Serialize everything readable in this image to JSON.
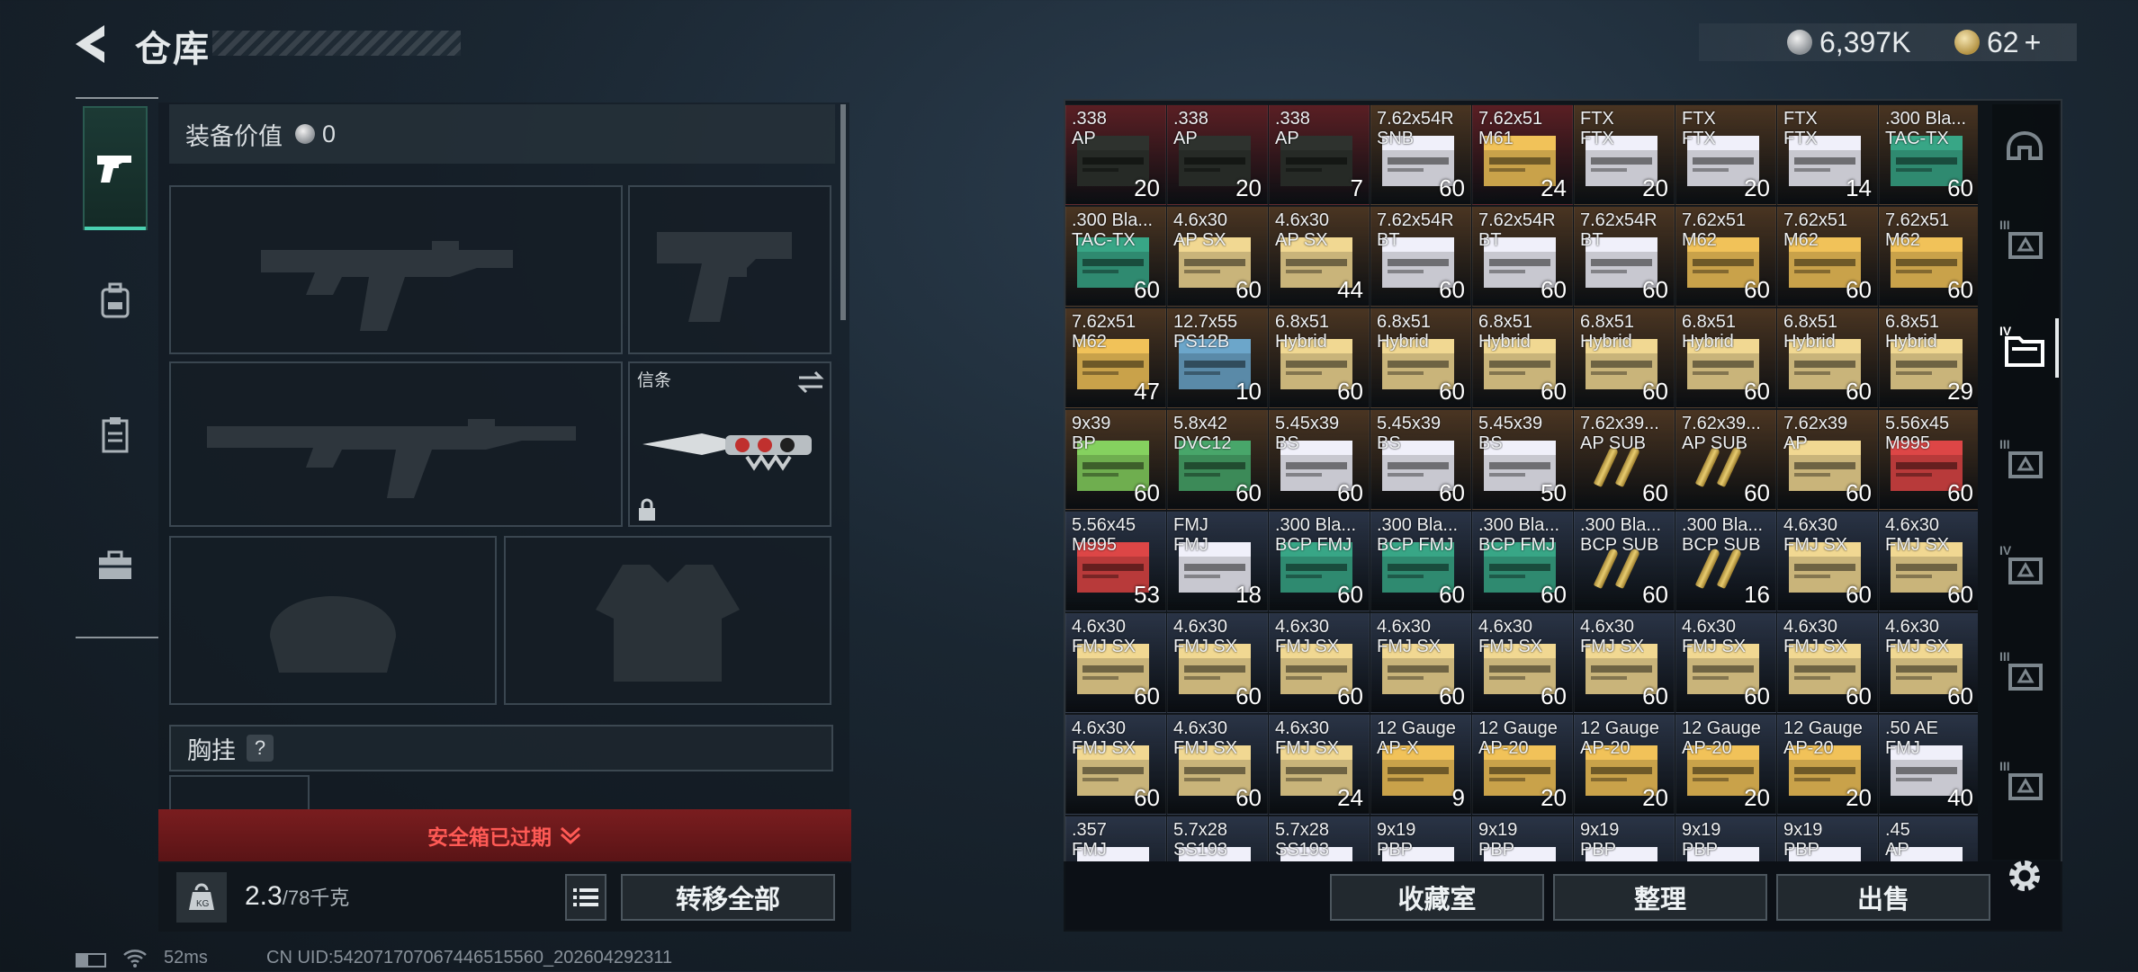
{
  "header": {
    "title": "仓库",
    "currencies": [
      {
        "icon": "silver-coin-icon",
        "value": "6,397K"
      },
      {
        "icon": "gold-coin-icon",
        "value": "62"
      }
    ],
    "add_label": "+"
  },
  "nav": {
    "items": [
      {
        "name": "weapons",
        "icon": "pistol-icon",
        "active": true
      },
      {
        "name": "backpack",
        "icon": "backpack-icon",
        "active": false
      },
      {
        "name": "clipboard",
        "icon": "clipboard-icon",
        "active": false
      },
      {
        "name": "case",
        "icon": "briefcase-icon",
        "active": false
      }
    ]
  },
  "loadout": {
    "equip_value_label": "装备价值",
    "equip_value": "0",
    "melee_slot_label": "信条",
    "chest_rig_label": "胸挂",
    "chest_rig_help": "?",
    "secure_container_status": "安全箱已过期",
    "weight_current": "2.3",
    "weight_max": "/78千克",
    "transfer_all_label": "转移全部"
  },
  "inventory": {
    "rows": [
      [
        {
          "l1": ".338",
          "l2": "AP",
          "count": "20",
          "color": "#262a26",
          "bg": "#5a1f24"
        },
        {
          "l1": ".338",
          "l2": "AP",
          "count": "20",
          "color": "#262a26",
          "bg": "#5a1f24"
        },
        {
          "l1": ".338",
          "l2": "AP",
          "count": "7",
          "color": "#262a26",
          "bg": "#5a1f24"
        },
        {
          "l1": "7.62x54R",
          "l2": "SNB",
          "count": "60",
          "color": "#c8c8d0",
          "bg": "#4a3522"
        },
        {
          "l1": "7.62x51",
          "l2": "M61",
          "count": "24",
          "color": "#c9a24a",
          "bg": "#5a1f24"
        },
        {
          "l1": "FTX",
          "l2": "FTX",
          "count": "20",
          "color": "#c8c8d0",
          "bg": "#4a3522"
        },
        {
          "l1": "FTX",
          "l2": "FTX",
          "count": "20",
          "color": "#c8c8d0",
          "bg": "#4a3522"
        },
        {
          "l1": "FTX",
          "l2": "FTX",
          "count": "14",
          "color": "#c8c8d0",
          "bg": "#4a3522"
        },
        {
          "l1": ".300 Bla...",
          "l2": "TAC-TX",
          "count": "60",
          "color": "#2f8a70",
          "bg": "#4a3522"
        }
      ],
      [
        {
          "l1": ".300 Bla...",
          "l2": "TAC-TX",
          "count": "60",
          "color": "#2f8a70",
          "bg": "#4a3522"
        },
        {
          "l1": "4.6x30",
          "l2": "AP SX",
          "count": "60",
          "color": "#c9b47a",
          "bg": "#4a3522"
        },
        {
          "l1": "4.6x30",
          "l2": "AP SX",
          "count": "44",
          "color": "#c9b47a",
          "bg": "#4a3522"
        },
        {
          "l1": "7.62x54R",
          "l2": "BT",
          "count": "60",
          "color": "#c8c8d0",
          "bg": "#4a3522"
        },
        {
          "l1": "7.62x54R",
          "l2": "BT",
          "count": "60",
          "color": "#c8c8d0",
          "bg": "#4a3522"
        },
        {
          "l1": "7.62x54R",
          "l2": "BT",
          "count": "60",
          "color": "#c8c8d0",
          "bg": "#4a3522"
        },
        {
          "l1": "7.62x51",
          "l2": "M62",
          "count": "60",
          "color": "#c9a24a",
          "bg": "#4a3522"
        },
        {
          "l1": "7.62x51",
          "l2": "M62",
          "count": "60",
          "color": "#c9a24a",
          "bg": "#4a3522"
        },
        {
          "l1": "7.62x51",
          "l2": "M62",
          "count": "60",
          "color": "#c9a24a",
          "bg": "#4a3522"
        }
      ],
      [
        {
          "l1": "7.62x51",
          "l2": "M62",
          "count": "47",
          "color": "#c9a24a",
          "bg": "#4a3522"
        },
        {
          "l1": "12.7x55",
          "l2": "PS12B",
          "count": "10",
          "color": "#5a8aa8",
          "bg": "#4a3522"
        },
        {
          "l1": "6.8x51",
          "l2": "Hybrid",
          "count": "60",
          "color": "#c9b47a",
          "bg": "#4a3522"
        },
        {
          "l1": "6.8x51",
          "l2": "Hybrid",
          "count": "60",
          "color": "#c9b47a",
          "bg": "#4a3522"
        },
        {
          "l1": "6.8x51",
          "l2": "Hybrid",
          "count": "60",
          "color": "#c9b47a",
          "bg": "#4a3522"
        },
        {
          "l1": "6.8x51",
          "l2": "Hybrid",
          "count": "60",
          "color": "#c9b47a",
          "bg": "#4a3522"
        },
        {
          "l1": "6.8x51",
          "l2": "Hybrid",
          "count": "60",
          "color": "#c9b47a",
          "bg": "#4a3522"
        },
        {
          "l1": "6.8x51",
          "l2": "Hybrid",
          "count": "60",
          "color": "#c9b47a",
          "bg": "#4a3522"
        },
        {
          "l1": "6.8x51",
          "l2": "Hybrid",
          "count": "29",
          "color": "#c9b47a",
          "bg": "#4a3522"
        }
      ],
      [
        {
          "l1": "9x39",
          "l2": "BP",
          "count": "60",
          "color": "#6fae4f",
          "bg": "#4a3522"
        },
        {
          "l1": "5.8x42",
          "l2": "DVC12",
          "count": "60",
          "color": "#3c8a58",
          "bg": "#4a3522"
        },
        {
          "l1": "5.45x39",
          "l2": "BS",
          "count": "60",
          "color": "#c8c8d0",
          "bg": "#4a3522"
        },
        {
          "l1": "5.45x39",
          "l2": "BS",
          "count": "60",
          "color": "#c8c8d0",
          "bg": "#4a3522"
        },
        {
          "l1": "5.45x39",
          "l2": "BS",
          "count": "50",
          "color": "#c8c8d0",
          "bg": "#4a3522"
        },
        {
          "l1": "7.62x39...",
          "l2": "AP SUB",
          "count": "60",
          "color": "bullet",
          "bg": "#4a3522"
        },
        {
          "l1": "7.62x39...",
          "l2": "AP SUB",
          "count": "60",
          "color": "bullet",
          "bg": "#4a3522"
        },
        {
          "l1": "7.62x39",
          "l2": "AP",
          "count": "60",
          "color": "#c9b47a",
          "bg": "#4a3522"
        },
        {
          "l1": "5.56x45",
          "l2": "M995",
          "count": "60",
          "color": "#b83a3a",
          "bg": "#4a3522"
        }
      ],
      [
        {
          "l1": "5.56x45",
          "l2": "M995",
          "count": "53",
          "color": "#b83a3a",
          "bg": "#2a3446"
        },
        {
          "l1": "FMJ",
          "l2": "FMJ",
          "count": "18",
          "color": "#c8c8d0",
          "bg": "#2a3446"
        },
        {
          "l1": ".300 Bla...",
          "l2": "BCP FMJ",
          "count": "60",
          "color": "#2f8a70",
          "bg": "#2a3446"
        },
        {
          "l1": ".300 Bla...",
          "l2": "BCP FMJ",
          "count": "60",
          "color": "#2f8a70",
          "bg": "#2a3446"
        },
        {
          "l1": ".300 Bla...",
          "l2": "BCP FMJ",
          "count": "60",
          "color": "#2f8a70",
          "bg": "#2a3446"
        },
        {
          "l1": ".300 Bla...",
          "l2": "BCP SUB",
          "count": "60",
          "color": "bullet",
          "bg": "#2a3446"
        },
        {
          "l1": ".300 Bla...",
          "l2": "BCP SUB",
          "count": "16",
          "color": "bullet",
          "bg": "#2a3446"
        },
        {
          "l1": "4.6x30",
          "l2": "FMJ SX",
          "count": "60",
          "color": "#c9b47a",
          "bg": "#2a3446"
        },
        {
          "l1": "4.6x30",
          "l2": "FMJ SX",
          "count": "60",
          "color": "#c9b47a",
          "bg": "#2a3446"
        }
      ],
      [
        {
          "l1": "4.6x30",
          "l2": "FMJ SX",
          "count": "60",
          "color": "#c9b47a",
          "bg": "#2a3446"
        },
        {
          "l1": "4.6x30",
          "l2": "FMJ SX",
          "count": "60",
          "color": "#c9b47a",
          "bg": "#2a3446"
        },
        {
          "l1": "4.6x30",
          "l2": "FMJ SX",
          "count": "60",
          "color": "#c9b47a",
          "bg": "#2a3446"
        },
        {
          "l1": "4.6x30",
          "l2": "FMJ SX",
          "count": "60",
          "color": "#c9b47a",
          "bg": "#2a3446"
        },
        {
          "l1": "4.6x30",
          "l2": "FMJ SX",
          "count": "60",
          "color": "#c9b47a",
          "bg": "#2a3446"
        },
        {
          "l1": "4.6x30",
          "l2": "FMJ SX",
          "count": "60",
          "color": "#c9b47a",
          "bg": "#2a3446"
        },
        {
          "l1": "4.6x30",
          "l2": "FMJ SX",
          "count": "60",
          "color": "#c9b47a",
          "bg": "#2a3446"
        },
        {
          "l1": "4.6x30",
          "l2": "FMJ SX",
          "count": "60",
          "color": "#c9b47a",
          "bg": "#2a3446"
        },
        {
          "l1": "4.6x30",
          "l2": "FMJ SX",
          "count": "60",
          "color": "#c9b47a",
          "bg": "#2a3446"
        }
      ],
      [
        {
          "l1": "4.6x30",
          "l2": "FMJ SX",
          "count": "60",
          "color": "#c9b47a",
          "bg": "#2a3446"
        },
        {
          "l1": "4.6x30",
          "l2": "FMJ SX",
          "count": "60",
          "color": "#c9b47a",
          "bg": "#2a3446"
        },
        {
          "l1": "4.6x30",
          "l2": "FMJ SX",
          "count": "24",
          "color": "#c9b47a",
          "bg": "#2a3446"
        },
        {
          "l1": "12 Gauge",
          "l2": "AP-X",
          "count": "9",
          "color": "#c9a24a",
          "bg": "#2a3446"
        },
        {
          "l1": "12 Gauge",
          "l2": "AP-20",
          "count": "20",
          "color": "#c9a24a",
          "bg": "#2a3446"
        },
        {
          "l1": "12 Gauge",
          "l2": "AP-20",
          "count": "20",
          "color": "#c9a24a",
          "bg": "#2a3446"
        },
        {
          "l1": "12 Gauge",
          "l2": "AP-20",
          "count": "20",
          "color": "#c9a24a",
          "bg": "#2a3446"
        },
        {
          "l1": "12 Gauge",
          "l2": "AP-20",
          "count": "20",
          "color": "#c9a24a",
          "bg": "#2a3446"
        },
        {
          "l1": ".50 AE",
          "l2": "FMJ",
          "count": "40",
          "color": "#c8c8d0",
          "bg": "#2a3446"
        }
      ],
      [
        {
          "l1": ".357",
          "l2": "FMJ",
          "count": "",
          "color": "#c8c8d0",
          "bg": "#2a3446"
        },
        {
          "l1": "5.7x28",
          "l2": "SS193",
          "count": "",
          "color": "#c8c8d0",
          "bg": "#2a3446"
        },
        {
          "l1": "5.7x28",
          "l2": "SS193",
          "count": "",
          "color": "#c8c8d0",
          "bg": "#2a3446"
        },
        {
          "l1": "9x19",
          "l2": "PBP",
          "count": "",
          "color": "#c8c8d0",
          "bg": "#2a3446"
        },
        {
          "l1": "9x19",
          "l2": "PBP",
          "count": "",
          "color": "#c8c8d0",
          "bg": "#2a3446"
        },
        {
          "l1": "9x19",
          "l2": "PBP",
          "count": "",
          "color": "#c8c8d0",
          "bg": "#2a3446"
        },
        {
          "l1": "9x19",
          "l2": "PBP",
          "count": "",
          "color": "#c8c8d0",
          "bg": "#2a3446"
        },
        {
          "l1": "9x19",
          "l2": "PBP",
          "count": "",
          "color": "#c8c8d0",
          "bg": "#2a3446"
        },
        {
          "l1": ".45",
          "l2": "AP",
          "count": "",
          "color": "#c8c8d0",
          "bg": "#2a3446"
        }
      ]
    ],
    "buttons": {
      "collection": "收藏室",
      "sort": "整理",
      "sell": "出售"
    }
  },
  "rail": {
    "items": [
      {
        "name": "helmet",
        "icon": "helmet-icon",
        "badge": ""
      },
      {
        "name": "tier3-backpack",
        "icon": "backpack-tier-icon",
        "badge": "III"
      },
      {
        "name": "tier4-folder",
        "icon": "folder-icon",
        "badge": "IV",
        "active": true
      },
      {
        "name": "tier3-weapon",
        "icon": "weapon-case-icon",
        "badge": "III"
      },
      {
        "name": "tier4-medical",
        "icon": "medical-case-icon",
        "badge": "IV"
      },
      {
        "name": "tier3-warning",
        "icon": "hazard-case-icon",
        "badge": "III"
      },
      {
        "name": "tier3-warning-2",
        "icon": "hazard-case-icon",
        "badge": "III"
      }
    ]
  },
  "status": {
    "ping": "52ms",
    "uid": "CN UID:542071707067446515560_202604292311"
  }
}
